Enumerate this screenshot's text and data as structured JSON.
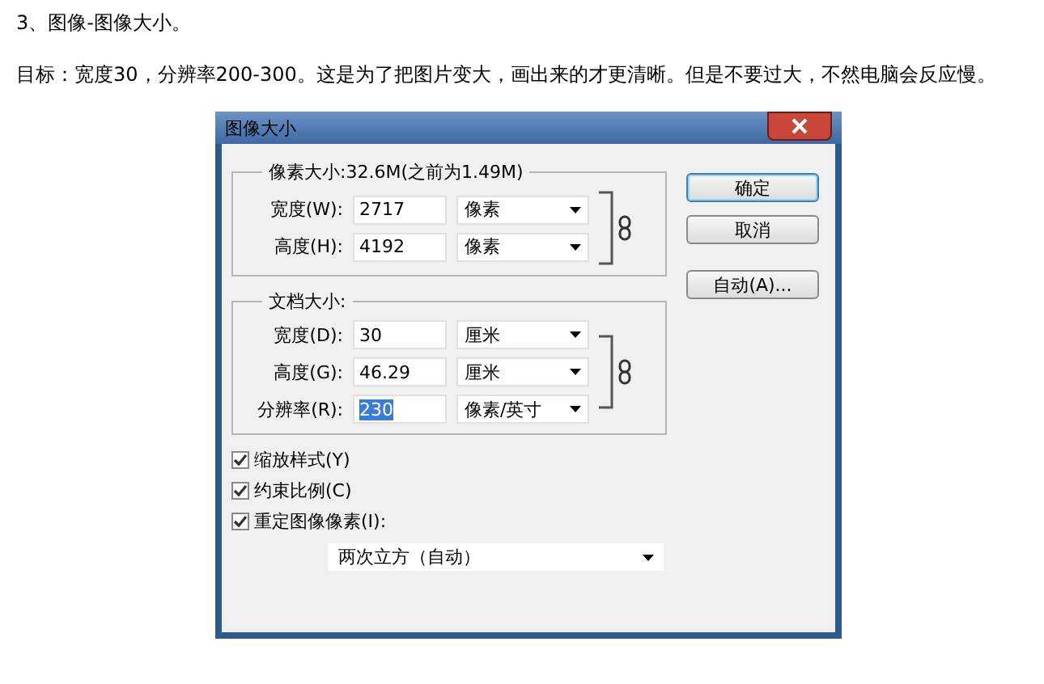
{
  "heading": "3、图像-图像大小。",
  "paragraph": "目标：宽度30，分辨率200-300。这是为了把图片变大，画出来的才更清晰。但是不要过大，不然电脑会反应慢。",
  "dialog": {
    "title": "图像大小",
    "pixel_dimensions": {
      "legend": "像素大小:32.6M(之前为1.49M)",
      "linked": true,
      "fields": [
        {
          "label": "宽度(W):",
          "value": "2717",
          "unit": "像素",
          "selected": false
        },
        {
          "label": "高度(H):",
          "value": "4192",
          "unit": "像素",
          "selected": false
        }
      ]
    },
    "document_size": {
      "legend": "文档大小:",
      "linked": true,
      "fields": [
        {
          "label": "宽度(D):",
          "value": "30",
          "unit": "厘米",
          "selected": false
        },
        {
          "label": "高度(G):",
          "value": "46.29",
          "unit": "厘米",
          "selected": false
        },
        {
          "label": "分辨率(R):",
          "value": "230",
          "unit": "像素/英寸",
          "selected": true
        }
      ]
    },
    "buttons": [
      {
        "label": "确定",
        "default": true
      },
      {
        "label": "取消",
        "default": false
      },
      {
        "label": "自动(A)...",
        "default": false
      }
    ],
    "checkboxes": [
      {
        "label": "缩放样式(Y)",
        "checked": true
      },
      {
        "label": "约束比例(C)",
        "checked": true
      },
      {
        "label": "重定图像像素(I):",
        "checked": true
      }
    ],
    "resample": {
      "value": "两次立方（自动）"
    }
  }
}
